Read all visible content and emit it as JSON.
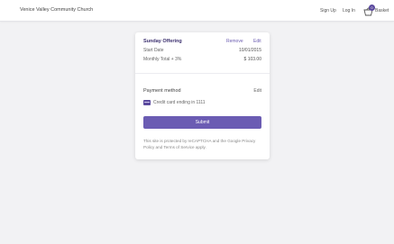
{
  "header": {
    "org_name": "Venice Valley Community Church",
    "signup_label": "Sign Up",
    "login_label": "Log In",
    "basket_label": "Basket",
    "basket_count": "0",
    "basket_icon": "basket-icon"
  },
  "offering": {
    "title": "Sunday Offering",
    "remove_label": "Remove",
    "edit_label": "Edit",
    "start_date_label": "Start Date",
    "start_date_value": "10/01/2015",
    "monthly_total_label": "Monthly Total + 3%",
    "monthly_total_value": "$ 103.00"
  },
  "payment": {
    "title": "Payment method",
    "edit_label": "Edit",
    "card_icon": "credit-card-icon",
    "card_text": "Credit card ending in 1111"
  },
  "submit_label": "Submit",
  "recaptcha_text": "This site is protected by reCAPTCHA and the Google Privacy Policy and Terms of Service apply.",
  "colors": {
    "accent": "#6b5cb3",
    "title": "#3b2f6e",
    "background": "#f2f2f4"
  }
}
